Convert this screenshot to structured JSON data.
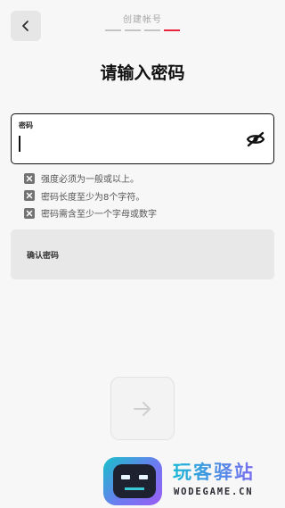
{
  "header": {
    "title": "创建帐号",
    "steps_total": 4,
    "step_current": 4
  },
  "page_title": "请输入密码",
  "password_field": {
    "label": "密码",
    "value": "",
    "visibility": "hidden"
  },
  "rules": [
    {
      "text": "强度必须为一般或以上。",
      "met": false
    },
    {
      "text": "密码长度至少为8个字符。",
      "met": false
    },
    {
      "text": "密码需含至少一个字母或数字",
      "met": false
    }
  ],
  "confirm_field": {
    "label": "确认密码"
  },
  "next_button": {
    "icon": "arrow-right-icon",
    "enabled": false
  },
  "watermark": {
    "title": "玩客驿站",
    "domain": "WODEGAME.CN"
  },
  "colors": {
    "accent": "#e8253f",
    "background": "#f7f7f7"
  }
}
